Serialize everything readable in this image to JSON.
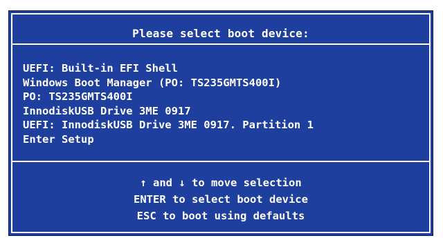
{
  "dialog": {
    "title": "Please select boot device:",
    "boot_options": [
      "UEFI: Built-in EFI Shell",
      "Windows Boot Manager (PO: TS235GMTS400I)",
      "PO: TS235GMTS400I",
      "InnodiskUSB Drive 3ME 0917",
      "UEFI: InnodiskUSB Drive 3ME 0917. Partition 1",
      "Enter Setup"
    ],
    "help": {
      "line1_up_icon": "up-arrow",
      "line1_and": "and",
      "line1_down_icon": "down-arrow",
      "line1_rest": "to move selection",
      "line2": "ENTER to select boot device",
      "line3": "ESC to boot using defaults"
    }
  },
  "colors": {
    "background": "#1f3f9f",
    "text": "#ffffff",
    "outer": "#ffffff"
  }
}
